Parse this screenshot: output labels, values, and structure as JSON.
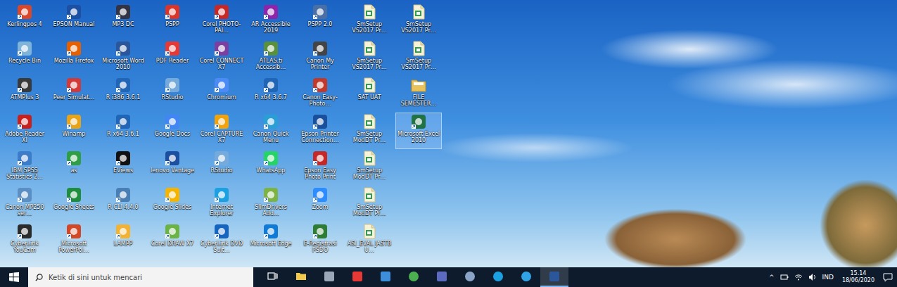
{
  "desktop": {
    "icons": [
      {
        "label": "Kerlingpos 4",
        "kind": "app",
        "color": "#d9472b",
        "selected": false
      },
      {
        "label": "Recycle Bin",
        "kind": "app",
        "color": "#7fb4d8",
        "selected": false
      },
      {
        "label": "ATMPlus 3",
        "kind": "app",
        "color": "#3a3a3a",
        "selected": false
      },
      {
        "label": "Adobe Reader XI",
        "kind": "app",
        "color": "#c8201d",
        "selected": false
      },
      {
        "label": "IBM SPSS Statistics 2…",
        "kind": "app",
        "color": "#3d7cc9",
        "selected": false
      },
      {
        "label": "Canon MP250 ser…",
        "kind": "app",
        "color": "#5b8fc4",
        "selected": false
      },
      {
        "label": "CyberLink YouCam",
        "kind": "app",
        "color": "#2b2b2b",
        "selected": false
      },
      {
        "label": "EPSON Manual",
        "kind": "app",
        "color": "#1d4fa3",
        "selected": false
      },
      {
        "label": "Mozilla Firefox",
        "kind": "app",
        "color": "#e66000",
        "selected": false
      },
      {
        "label": "Peer Simulat…",
        "kind": "app",
        "color": "#d23a3a",
        "selected": false
      },
      {
        "label": "Winamp",
        "kind": "app",
        "color": "#e8a317",
        "selected": false
      },
      {
        "label": "as",
        "kind": "app",
        "color": "#2f9e44",
        "selected": false
      },
      {
        "label": "Google Sheets",
        "kind": "app",
        "color": "#1e8e3e",
        "selected": false
      },
      {
        "label": "Microsoft PowerPoi…",
        "kind": "app",
        "color": "#d24726",
        "selected": false
      },
      {
        "label": "MP3 DC",
        "kind": "app",
        "color": "#333344",
        "selected": false
      },
      {
        "label": "Microsoft Word 2010",
        "kind": "app",
        "color": "#2b579a",
        "selected": false
      },
      {
        "label": "R i386 3.6.1",
        "kind": "app",
        "color": "#2165b6",
        "selected": false
      },
      {
        "label": "R x64 3.6.1",
        "kind": "app",
        "color": "#2165b6",
        "selected": false
      },
      {
        "label": "EViews",
        "kind": "app",
        "color": "#111111",
        "selected": false
      },
      {
        "label": "R CLI 4.4.0",
        "kind": "app",
        "color": "#4a7fb5",
        "selected": false
      },
      {
        "label": "LAMPP",
        "kind": "app",
        "color": "#f2b233",
        "selected": false
      },
      {
        "label": "PSPP",
        "kind": "app",
        "color": "#d9352b",
        "selected": false
      },
      {
        "label": "PDF Reader",
        "kind": "app",
        "color": "#e53935",
        "selected": false
      },
      {
        "label": "RStudio",
        "kind": "app",
        "color": "#75aadb",
        "selected": false
      },
      {
        "label": "Google Docs",
        "kind": "app",
        "color": "#4285f4",
        "selected": false
      },
      {
        "label": "lenovo Vantage",
        "kind": "app",
        "color": "#1c4fa0",
        "selected": false
      },
      {
        "label": "Google Slides",
        "kind": "app",
        "color": "#f4b400",
        "selected": false
      },
      {
        "label": "Corel DRAW X7",
        "kind": "app",
        "color": "#6bb345",
        "selected": false
      },
      {
        "label": "Corel PHOTO-PAI…",
        "kind": "app",
        "color": "#c62828",
        "selected": false
      },
      {
        "label": "Corel CONNECT X7",
        "kind": "app",
        "color": "#7b3fa0",
        "selected": false
      },
      {
        "label": "Chromium",
        "kind": "app",
        "color": "#4c8bf5",
        "selected": false
      },
      {
        "label": "Corel CAPTURE X7",
        "kind": "app",
        "color": "#f0a30a",
        "selected": false
      },
      {
        "label": "RStudio",
        "kind": "app",
        "color": "#75aadb",
        "selected": false
      },
      {
        "label": "Internet Explorer",
        "kind": "app",
        "color": "#1ba1e2",
        "selected": false
      },
      {
        "label": "CyberLink DVD Suit…",
        "kind": "app",
        "color": "#1565c0",
        "selected": false
      },
      {
        "label": "AR Accessible 2019",
        "kind": "app",
        "color": "#8e24aa",
        "selected": false
      },
      {
        "label": "ATLAS.ti Accessib…",
        "kind": "app",
        "color": "#5a8f3c",
        "selected": false
      },
      {
        "label": "R x64 3.6.7",
        "kind": "app",
        "color": "#2165b6",
        "selected": false
      },
      {
        "label": "Canon Quick Menu",
        "kind": "app",
        "color": "#2a9fd6",
        "selected": false
      },
      {
        "label": "WhatsApp",
        "kind": "app",
        "color": "#25d366",
        "selected": false
      },
      {
        "label": "SlimDrivers Add…",
        "kind": "app",
        "color": "#7cb342",
        "selected": false
      },
      {
        "label": "Microsoft Edge",
        "kind": "app",
        "color": "#0f7bd6",
        "selected": false
      },
      {
        "label": "PSPP 2.0",
        "kind": "app",
        "color": "#4a6fa5",
        "selected": false
      },
      {
        "label": "Canon My Printer",
        "kind": "app",
        "color": "#444444",
        "selected": false
      },
      {
        "label": "Canon Easy-Photo…",
        "kind": "app",
        "color": "#c0392b",
        "selected": false
      },
      {
        "label": "Epson Printer Connection…",
        "kind": "app",
        "color": "#1a4f9c",
        "selected": false
      },
      {
        "label": "Epson Easy Photo Print",
        "kind": "app",
        "color": "#c62828",
        "selected": false
      },
      {
        "label": "Zoom",
        "kind": "app",
        "color": "#2d8cff",
        "selected": false
      },
      {
        "label": "E-Registrasi PSDO",
        "kind": "app",
        "color": "#2e7d32",
        "selected": false
      },
      {
        "label": "SmSetup VS2017 Pr…",
        "kind": "file",
        "color": "#2e9e4f",
        "selected": false
      },
      {
        "label": "SmSetup VS2017 Pr…",
        "kind": "file",
        "color": "#2e9e4f",
        "selected": false
      },
      {
        "label": "SAT UAT",
        "kind": "file",
        "color": "#2e9e4f",
        "selected": false
      },
      {
        "label": "SmSetup ModDT Pr…",
        "kind": "file",
        "color": "#2e9e4f",
        "selected": false
      },
      {
        "label": "SmSetup ModDT Pr…",
        "kind": "file",
        "color": "#2e9e4f",
        "selected": false
      },
      {
        "label": "SmSetup ModDT Pr…",
        "kind": "file",
        "color": "#2e9e4f",
        "selected": false
      },
      {
        "label": "ASI_EVAL JASTB U…",
        "kind": "file",
        "color": "#2e9e4f",
        "selected": false
      },
      {
        "label": "SmSetup VS2017 Pr…",
        "kind": "file",
        "color": "#2e9e4f",
        "selected": false
      },
      {
        "label": "SmSetup VS2017 Pr…",
        "kind": "file",
        "color": "#2e9e4f",
        "selected": false
      },
      {
        "label": "FILE SEMESTER…",
        "kind": "folder",
        "color": "#e8c25a",
        "selected": false
      },
      {
        "label": "Microsoft Excel 2010",
        "kind": "app",
        "color": "#217346",
        "selected": true
      }
    ]
  },
  "taskbar": {
    "search": {
      "placeholder": "Ketik di sini untuk mencari"
    },
    "apps": [
      {
        "name": "task-view",
        "color": "#ffffff",
        "selected": false
      },
      {
        "name": "file-explorer",
        "color": "#f2c94c",
        "selected": false
      },
      {
        "name": "store",
        "color": "#9aa7b8",
        "selected": false
      },
      {
        "name": "calendar",
        "color": "#e53935",
        "selected": false
      },
      {
        "name": "mail",
        "color": "#3d8fd9",
        "selected": false
      },
      {
        "name": "chrome",
        "color": "#4caf50",
        "selected": false
      },
      {
        "name": "settings",
        "color": "#5c6bc0",
        "selected": false
      },
      {
        "name": "cortana",
        "color": "#8aa4c8",
        "selected": false
      },
      {
        "name": "internet-explorer",
        "color": "#1ba1e2",
        "selected": false
      },
      {
        "name": "edge",
        "color": "#2fa4e7",
        "selected": false
      },
      {
        "name": "word",
        "color": "#2b579a",
        "selected": true
      }
    ],
    "tray": {
      "chevron": "^",
      "language": "IND",
      "time": "15.14",
      "date": "18/06/2020"
    }
  }
}
